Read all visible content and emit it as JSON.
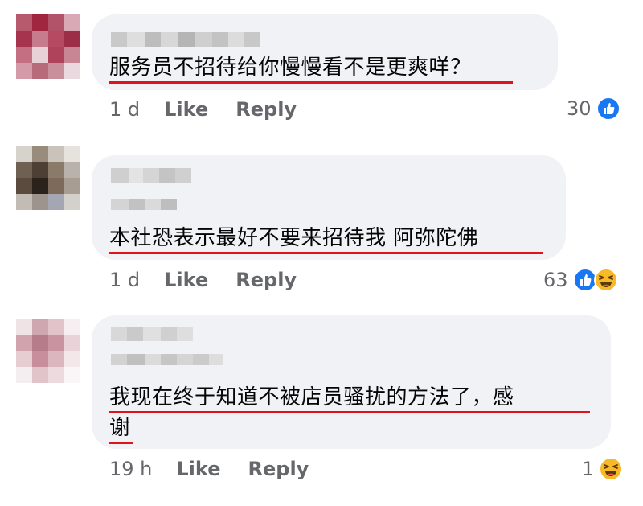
{
  "comments": [
    {
      "text_lines": [
        "服务员不招待给你慢慢看不是更爽咩？"
      ],
      "time": "1 d",
      "like_label": "Like",
      "reply_label": "Reply",
      "reaction_count": "30",
      "reactions": [
        "like-icon"
      ]
    },
    {
      "text_lines": [
        "本社恐表示最好不要来招待我 阿弥陀佛"
      ],
      "time": "1 d",
      "like_label": "Like",
      "reply_label": "Reply",
      "reaction_count": "63",
      "reactions": [
        "like-icon",
        "haha-icon"
      ]
    },
    {
      "text_lines": [
        "我现在终于知道不被店员骚扰的方法了，感",
        "谢"
      ],
      "time": "19 h",
      "like_label": "Like",
      "reply_label": "Reply",
      "reaction_count": "1",
      "reactions": [
        "haha-icon"
      ]
    }
  ],
  "colors": {
    "bubble": "#f0f2f5",
    "underline": "#e0121b",
    "meta_text": "#65676b",
    "like_blue": "#1877f2",
    "haha_yellow": "#f7b928"
  }
}
